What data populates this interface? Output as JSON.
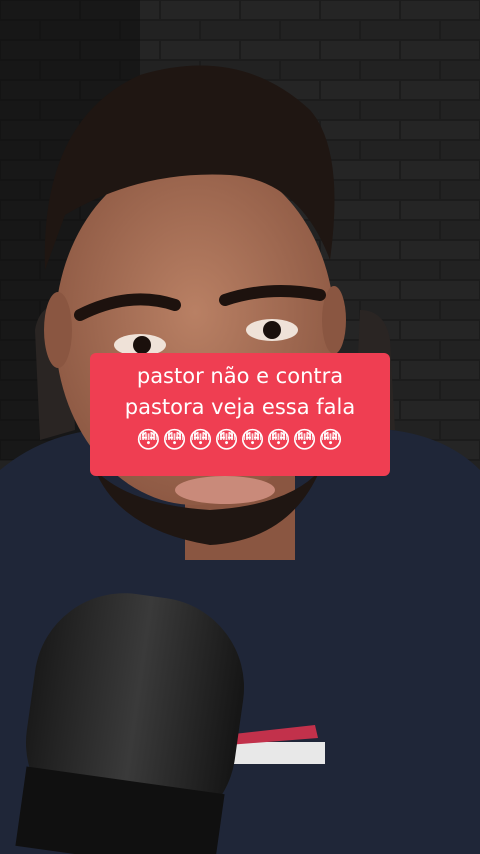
{
  "caption": {
    "line1": "pastor não e contra",
    "line2": "pastora veja essa fala",
    "emojis": "😳😳😳😳😳😳😳😳"
  },
  "colors": {
    "caption_background": "#ef3e52",
    "caption_text": "#ffffff",
    "wall": "#1b1b1b",
    "shirt": "#1f2638",
    "skin": "#a8715a"
  }
}
